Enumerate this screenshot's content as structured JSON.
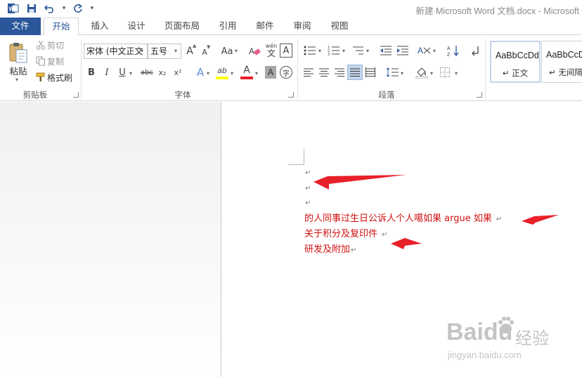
{
  "window": {
    "title": "新建 Microsoft Word 文档.docx - Microsoft"
  },
  "tabs": [
    {
      "label": "文件"
    },
    {
      "label": "开始"
    },
    {
      "label": "插入"
    },
    {
      "label": "设计"
    },
    {
      "label": "页面布局"
    },
    {
      "label": "引用"
    },
    {
      "label": "邮件"
    },
    {
      "label": "审阅"
    },
    {
      "label": "视图"
    }
  ],
  "clipboard": {
    "paste": "粘贴",
    "cut": "剪切",
    "copy": "复制",
    "format_painter": "格式刷",
    "group_label": "剪贴板"
  },
  "font": {
    "font_name": "宋体 (中文正文",
    "font_size": "五号",
    "group_label": "字体",
    "grow": "A",
    "shrink": "A",
    "case": "Aa",
    "phonetic": "wén",
    "phonetic_char": "文",
    "border_char": "A",
    "bold": "B",
    "italic": "I",
    "underline": "U",
    "strike": "abc",
    "subscript": "x₂",
    "superscript": "x²",
    "effects": "A",
    "highlight": "ab",
    "color": "A",
    "shading": "A",
    "enclose": "字"
  },
  "paragraph": {
    "group_label": "段落"
  },
  "styles": [
    {
      "sample": "AaBbCcDd",
      "name": "↵ 正文"
    },
    {
      "sample": "AaBbCcDd",
      "name": "↵ 无间隔"
    }
  ],
  "document": {
    "empty_marks": [
      "↵",
      "↵",
      "↵"
    ],
    "lines": [
      {
        "text": "的人同事过生日公诉人个人噶如果 argue 如果",
        "mark": "↵"
      },
      {
        "text": "关于积分及复印件",
        "mark": "↵"
      },
      {
        "text": "研发及附加",
        "mark": "↵"
      }
    ]
  },
  "watermark": {
    "brand": "Baidu",
    "brand_cn": "经验",
    "url": "jingyan.baidu.com"
  },
  "colors": {
    "accent": "#2b579a",
    "text_red": "#d01010",
    "arrow_red": "#e8202a",
    "highlight": "#ffff00"
  }
}
